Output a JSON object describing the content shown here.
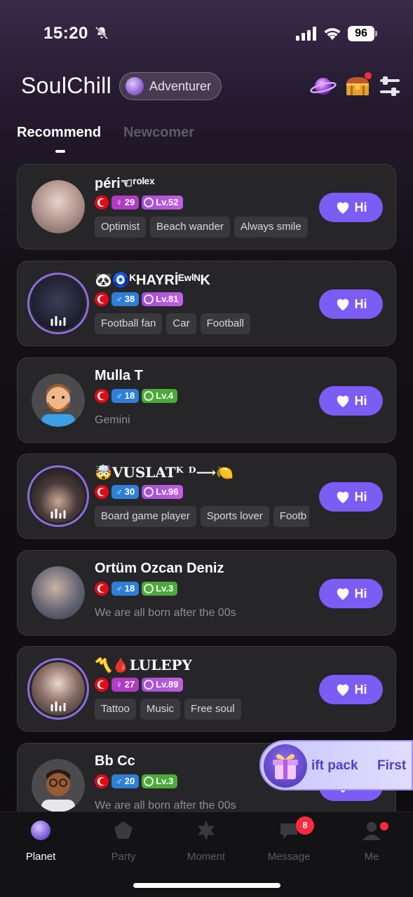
{
  "status": {
    "time": "15:20",
    "battery": "96"
  },
  "header": {
    "title": "SoulChill",
    "badge": "Adventurer"
  },
  "tabs": {
    "recommend": "Recommend",
    "newcomer": "Newcomer"
  },
  "users": [
    {
      "name": "péri☜ʳᵒˡᵉˣ",
      "gender": "♀",
      "age": "29",
      "level": "Lv.52",
      "tags": [
        "Optimist",
        "Beach wander",
        "Always smile"
      ]
    },
    {
      "name": "🐼🧿ᴷHAYRİᴱʷⁱᴺK",
      "gender": "♂",
      "age": "38",
      "level": "Lv.81",
      "tags": [
        "Football fan",
        "Car",
        "Football"
      ]
    },
    {
      "name": "Mulla T",
      "gender": "♂",
      "age": "18",
      "level": "Lv.4",
      "bio": "Gemini"
    },
    {
      "name": "🤯VUSLATᴷ ᴰ⟶🍋",
      "gender": "♂",
      "age": "30",
      "level": "Lv.96",
      "tags": [
        "Board game player",
        "Sports lover",
        "Footb"
      ]
    },
    {
      "name": "Ortüm Ozcan Deniz",
      "gender": "♂",
      "age": "18",
      "level": "Lv.3",
      "bio": "We are all born after the 00s"
    },
    {
      "name": "〽️🩸LULEPY",
      "gender": "♀",
      "age": "27",
      "level": "Lv.89",
      "tags": [
        "Tattoo",
        "Music",
        "Free soul"
      ]
    },
    {
      "name": "Bb Cc",
      "gender": "♂",
      "age": "20",
      "level": "Lv.3",
      "bio": "We are all born after the 00s"
    }
  ],
  "hi_label": "Hi",
  "gift": {
    "text": "ift pack",
    "text2": "First"
  },
  "nav": {
    "planet": "Planet",
    "party": "Party",
    "moment": "Moment",
    "message": "Message",
    "me": "Me",
    "message_badge": "8"
  },
  "colors": {
    "accent": "#7b5cf5",
    "female": "#b13bc4",
    "male": "#2e7fd6",
    "level_purple": "#a04fd6",
    "level_green": "#4caa3a"
  }
}
